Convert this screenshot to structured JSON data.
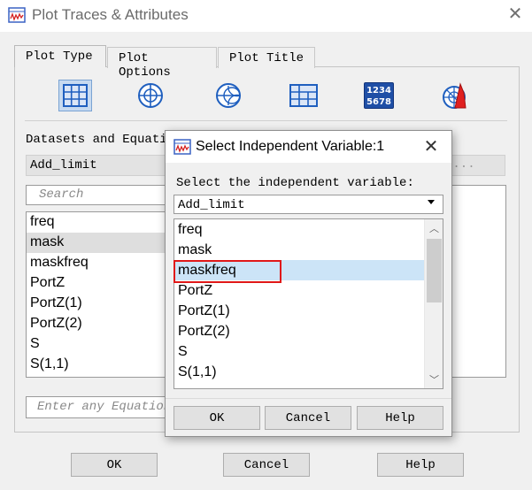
{
  "main_window": {
    "title": "Plot Traces & Attributes",
    "tabs": [
      {
        "label": "Plot Type",
        "active": true
      },
      {
        "label": "Plot Options",
        "active": false
      },
      {
        "label": "Plot Title",
        "active": false
      }
    ],
    "plot_type_icons": [
      "rectangular-plot-icon",
      "polar-plot-icon",
      "smith-chart-icon",
      "list-table-icon",
      "numeric-display-icon",
      "antenna-plot-icon"
    ],
    "numeric_icon_text": {
      "line1": "1234",
      "line2": "5678"
    },
    "datasets_label": "Datasets and Equatio",
    "dataset_value": "Add_limit",
    "dataset_suffix": "s...",
    "search_placeholder": "Search",
    "variables": [
      "freq",
      "mask",
      "maskfreq",
      "PortZ",
      "PortZ(1)",
      "PortZ(2)",
      "S",
      "S(1,1)"
    ],
    "highlighted_variable": "mask",
    "equation_placeholder": "Enter any Equation",
    "buttons": {
      "ok": "OK",
      "cancel": "Cancel",
      "help": "Help"
    }
  },
  "modal": {
    "title": "Select Independent Variable:1",
    "label": "Select the independent variable:",
    "selected_dataset": "Add_limit",
    "options": [
      "freq",
      "mask",
      "maskfreq",
      "PortZ",
      "PortZ(1)",
      "PortZ(2)",
      "S",
      "S(1,1)"
    ],
    "selected_option": "maskfreq",
    "buttons": {
      "ok": "OK",
      "cancel": "Cancel",
      "help": "Help"
    }
  },
  "colors": {
    "selection_blue": "#cce4f7",
    "annotation_red": "#e01818",
    "icon_blue": "#1f5fbf"
  }
}
